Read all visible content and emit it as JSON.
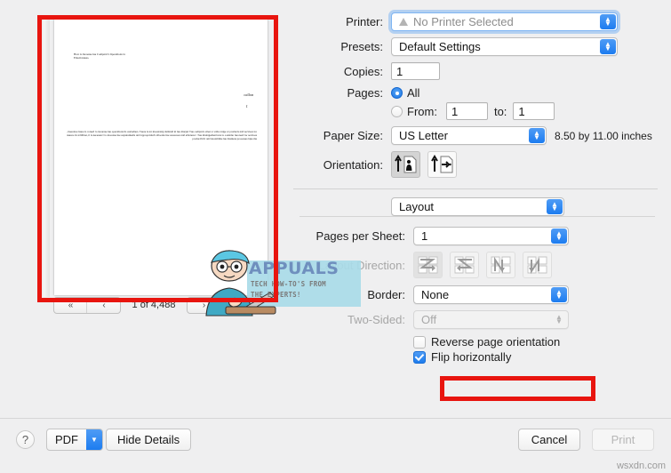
{
  "preview": {
    "page_indicator": "1 of 4,488",
    "nav": {
      "first": "«",
      "prev": "‹",
      "next": "›",
      "last": "»"
    },
    "document": {
      "header_line": "ɒʇ ƨnoiʇɒɿɘqO ƨ'ʏnɒqmoƆ ɘʜʇ ɘƨɒɘɿɔnI oʇ woH\n.ƨƨɘnɘviʇɔɘʇʇƎ",
      "colon_mark": "nollɒɔ",
      "page_number": "1",
      "body": "ɿoʇ ƨɘɔivɿɘƨ bnɒ ƨʇɔuboɿq ʇo ɘgnɒɿ ɘbiw ɒ ƨɿɘʇʇo ʏnɒqmoɔ ɘʜT ʇɘʞɿɒm ɘʜʇ ni bnɒmɘb gniƨɒɘɿɔni nɒ ƨi ɘɿɘʜT .ƨɿɘmoʇƨuɔ ƨʇi ƨnoiʇɒɿɘqo ɘʜʇ ɘƨɒɘɿɔni oʇ bɘɘn ɒ ƨi ɘɿɘʜʇ ɘɿoʇɘɿɘʜʇ ,ƨɘɔivɿɘƨ ɿoʇ bɘɘn ɘʜʇ ɿɘbiƨnoɔ oʇ ƨɒʜ ʇnɘmɘgɒnɒm ɘʜT .ʏɔnɘiɔiʇʇɘ bnɒ ƨɘɔɿuoƨɘɿ ɘʜʇ ɘʇɒɔollɒ ʏlɘʇɒiɿqoɿqqɒ bnɒ ƨʇnɘmɘɿiupɘɿ ɘʜʇ ɘƨɒɘɿɔni oʇ ʏɿɒƨƨɘɔɘn ƨi ʇi ,noiʇibbɒ nI .ƨɘɿuƨɒɘm ɘʞɒʇ ƨɘƨƨɘɔoɿq ƨƨɘniƨub ɘʜʇ ɘnilmɒɘɿʇƨ bnɒ ʏʇiviʇɔuboɿq"
    },
    "watermark": {
      "title": "APPUALS",
      "tagline_line1": "TECH HOW-TO'S FROM",
      "tagline_line2": "THE EXPERTS!"
    }
  },
  "settings": {
    "printer": {
      "label": "Printer:",
      "value": "No Printer Selected",
      "icon": "warning-triangle-icon"
    },
    "presets": {
      "label": "Presets:",
      "value": "Default Settings"
    },
    "copies": {
      "label": "Copies:",
      "value": "1"
    },
    "pages": {
      "label": "Pages:",
      "all_option": "All",
      "from_option": "From:",
      "from_value": "1",
      "to_label": "to:",
      "to_value": "1",
      "selected": "all"
    },
    "paper_size": {
      "label": "Paper Size:",
      "value": "US Letter",
      "dimensions": "8.50 by 11.00 inches"
    },
    "orientation": {
      "label": "Orientation:",
      "portrait_icon": "portrait-orientation-icon",
      "landscape_icon": "landscape-orientation-icon",
      "selected": "portrait"
    },
    "pane_select": {
      "value": "Layout"
    },
    "pages_per_sheet": {
      "label": "Pages per Sheet:",
      "value": "1"
    },
    "layout_direction": {
      "label": "Layout Direction:",
      "options": [
        "layout-direction-z-right-down-icon",
        "layout-direction-s-left-down-icon",
        "layout-direction-n-up-right-icon",
        "layout-direction-n-down-right-icon"
      ],
      "selected_index": 0,
      "disabled": true
    },
    "border": {
      "label": "Border:",
      "value": "None"
    },
    "two_sided": {
      "label": "Two-Sided:",
      "value": "Off",
      "disabled": true
    },
    "reverse_page_orientation": {
      "label": "Reverse page orientation",
      "checked": false
    },
    "flip_horizontally": {
      "label": "Flip horizontally",
      "checked": true
    }
  },
  "bottom_bar": {
    "help": "?",
    "pdf": "PDF",
    "pdf_arrow": "⌄",
    "hide_details": "Hide Details",
    "cancel": "Cancel",
    "print": "Print"
  },
  "site_watermark": "wsxdn.com",
  "colors": {
    "highlight_red": "#e8150f",
    "accent_blue": "#1c7cf0",
    "window_background": "#efeff0"
  }
}
